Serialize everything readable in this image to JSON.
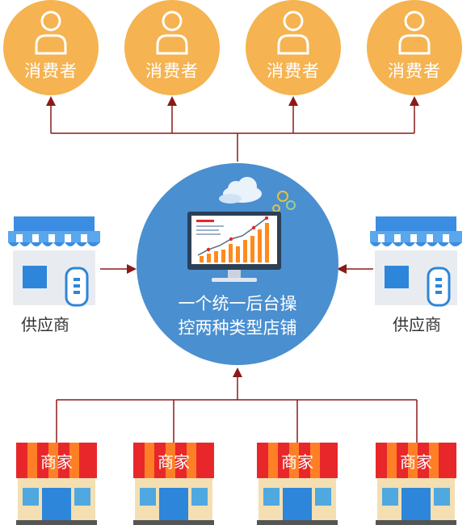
{
  "consumers": [
    {
      "label": "消费者"
    },
    {
      "label": "消费者"
    },
    {
      "label": "消费者"
    },
    {
      "label": "消费者"
    }
  ],
  "center": {
    "line1": "一个统一后台操",
    "line2": "控两种类型店铺"
  },
  "suppliers": [
    {
      "label": "供应商"
    },
    {
      "label": "供应商"
    }
  ],
  "merchants": [
    {
      "label": "商家"
    },
    {
      "label": "商家"
    },
    {
      "label": "商家"
    },
    {
      "label": "商家"
    }
  ],
  "colors": {
    "consumer_fill": "#f5b351",
    "hub_fill": "#4a8fd0",
    "connector": "#8b1a1a",
    "supplier_awning": "#3a8de0",
    "shop_awning_red": "#e8272a",
    "shop_awning_orange": "#ff7f27"
  }
}
